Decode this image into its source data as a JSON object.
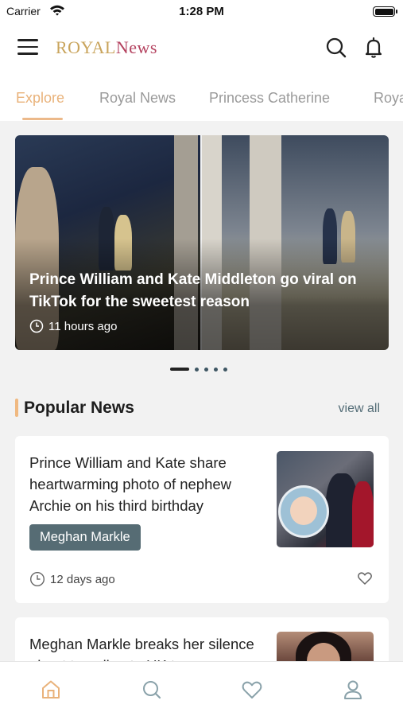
{
  "status_bar": {
    "carrier": "Carrier",
    "time": "1:28 PM"
  },
  "header": {
    "logo_royal": "ROYAL",
    "logo_news": "News",
    "icons": [
      "menu-icon",
      "search-icon",
      "bell-icon"
    ]
  },
  "tabs": [
    {
      "label": "Explore",
      "active": true
    },
    {
      "label": "Royal News",
      "active": false
    },
    {
      "label": "Princess Catherine",
      "active": false
    },
    {
      "label": "Roya",
      "active": false
    }
  ],
  "carousel": {
    "title": "Prince William and Kate Middleton go viral on TikTok for the sweetest reason",
    "time": "11 hours ago",
    "slide_count": 5,
    "active_index": 0
  },
  "popular": {
    "title": "Popular News",
    "view_all": "view all",
    "items": [
      {
        "title": "Prince William and Kate share heartwarming photo of nephew Archie on his third birthday",
        "tag": "Meghan Markle",
        "time": "12 days ago",
        "liked": false
      },
      {
        "title": "Meghan Markle breaks her silence about traveling to UK to"
      }
    ]
  },
  "bottom_nav": [
    "home-icon",
    "search-icon",
    "heart-icon",
    "profile-icon"
  ],
  "colors": {
    "accent": "#e9b27a",
    "brand_gold": "#c9a45c",
    "brand_rose": "#b4425f",
    "tag_bg": "#566c74"
  }
}
